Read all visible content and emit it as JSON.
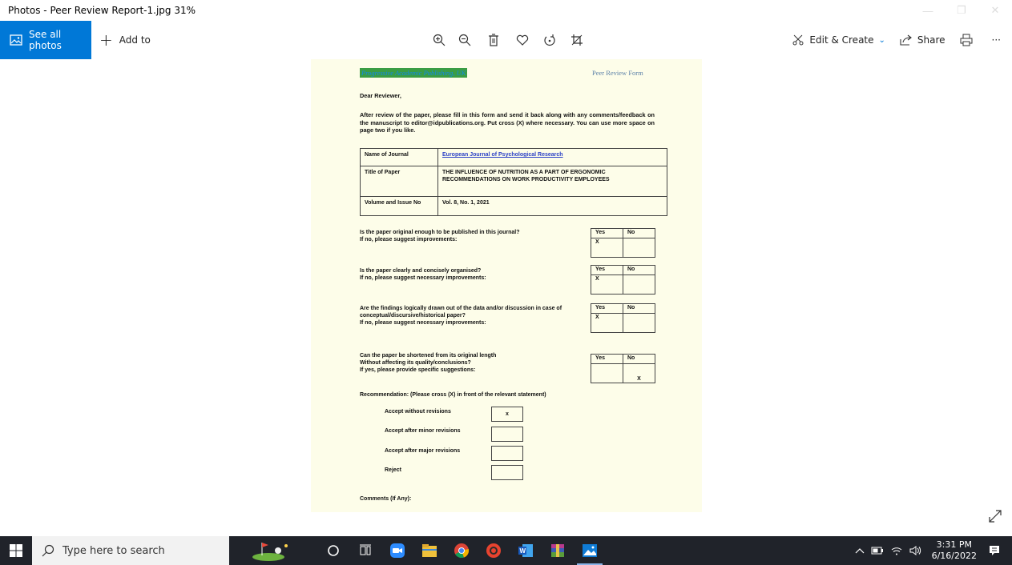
{
  "window": {
    "title": "Photos - Peer Review Report-1.jpg  31%",
    "minimize": "—",
    "maximize": "❐",
    "close": "✕"
  },
  "toolbar": {
    "see_all": "See all photos",
    "add_to": "Add to",
    "edit_create": "Edit & Create",
    "share": "Share",
    "more": "···"
  },
  "document": {
    "publisher": "Progressive Academic Publishing, UK",
    "form_title": "Peer Review Form",
    "greeting": "Dear Reviewer,",
    "intro": "After review of the paper, please fill in this form and send it back along with any comments/feedback on the manuscript to editor@idpublications.org. Put cross (X) where necessary. You can use more space on page two if you like.",
    "table": [
      {
        "label": "Name of Journal",
        "value": "European Journal of Psychological Research"
      },
      {
        "label": "Title of Paper",
        "value": "THE INFLUENCE OF NUTRITION AS A PART OF ERGONOMIC RECOMMENDATIONS ON WORK PRODUCTIVITY EMPLOYEES"
      },
      {
        "label": "Volume and Issue No",
        "value": "Vol. 8, No. 1, 2021"
      }
    ],
    "yes": "Yes",
    "no": "No",
    "questions": [
      {
        "text": "Is the paper original enough to be published in this journal?\nIf no, please suggest improvements:",
        "yes": "X",
        "no": ""
      },
      {
        "text": "Is the paper clearly and concisely organised?\nIf no, please suggest necessary improvements:",
        "yes": "X",
        "no": ""
      },
      {
        "text": "Are the findings logically drawn out of the data and/or discussion in case of conceptual/discursive/historical paper?\nIf no, please suggest necessary improvements:",
        "yes": "X",
        "no": ""
      },
      {
        "text": "Can the paper be shortened from its original length\nWithout affecting its quality/conclusions?\nIf yes, please provide specific suggestions:",
        "yes": "",
        "no": "X"
      }
    ],
    "recommendation_heading": "Recommendation: (Please cross (X) in front of the relevant statement)",
    "recommendations": [
      {
        "label": "Accept without revisions",
        "mark": "x"
      },
      {
        "label": "Accept after minor revisions",
        "mark": ""
      },
      {
        "label": "Accept after major revisions",
        "mark": ""
      },
      {
        "label": "Reject",
        "mark": ""
      }
    ],
    "comments": "Comments (If Any):"
  },
  "taskbar": {
    "search_placeholder": "Type here to search",
    "time": "3:31 PM",
    "date": "6/16/2022"
  }
}
